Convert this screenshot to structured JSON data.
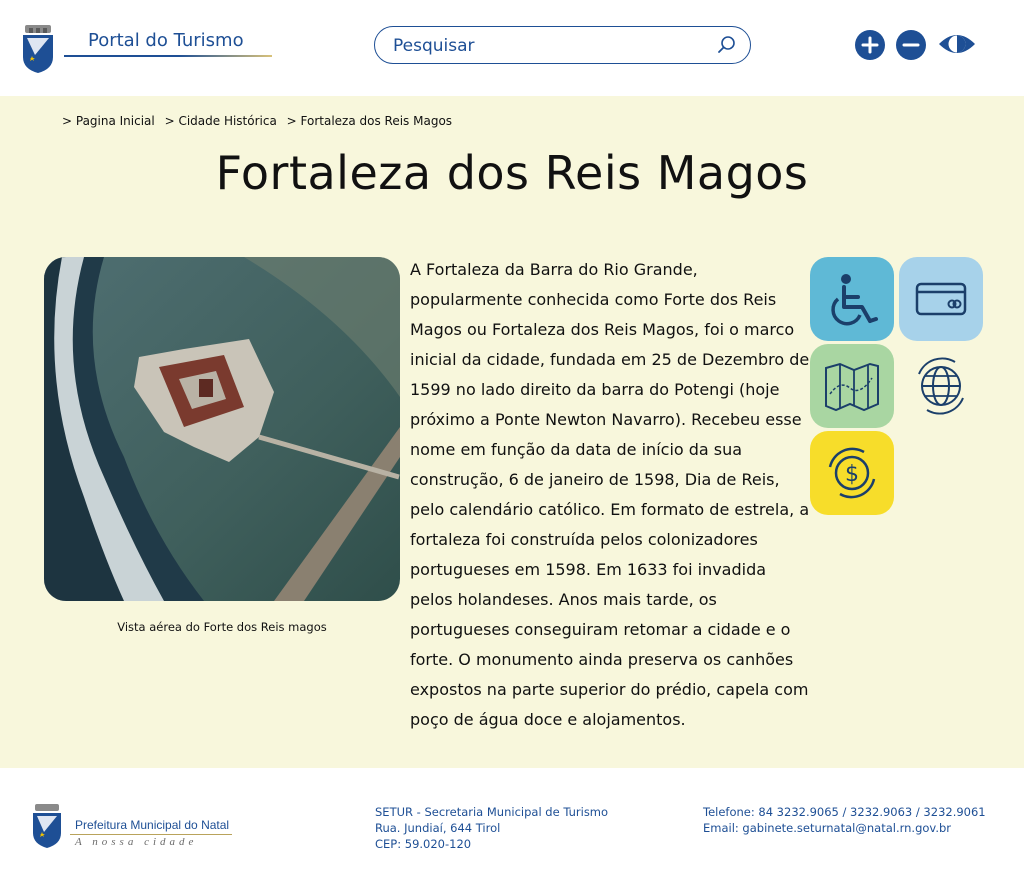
{
  "header": {
    "logo_title": "Portal do Turismo",
    "search_placeholder": "Pesquisar"
  },
  "breadcrumb": [
    "> Pagina Inicial",
    "> Cidade Histórica",
    "> Fortaleza dos Reis Magos"
  ],
  "page": {
    "title": "Fortaleza dos Reis Magos",
    "photo_caption": "Vista aérea do Forte dos Reis magos",
    "article": "A Fortaleza da Barra do Rio Grande, popularmente conhecida como Forte dos Reis Magos ou Fortaleza dos Reis Magos, foi o marco inicial da cidade, fundada em 25 de Dezembro de 1599  no lado direito da barra do Potengi (hoje próximo a Ponte Newton Navarro). Recebeu esse nome em função da data de início da sua construção, 6 de janeiro de 1598, Dia de Reis, pelo calendário católico. Em formato de estrela, a fortaleza foi construída pelos colonizadores portugueses em 1598. Em 1633 foi invadida pelos holandeses. Anos mais tarde, os portugueses conseguiram retomar a cidade e o forte. O monumento ainda preserva os canhões expostos na parte superior do prédio, capela com poço de água doce e alojamentos."
  },
  "tiles": {
    "accessibility_icon": "wheelchair-icon",
    "card_icon": "credit-card-icon",
    "map_icon": "map-icon",
    "globe_icon": "globe-icon",
    "money_icon": "currency-icon"
  },
  "colors": {
    "brand_blue": "#1e4f95",
    "content_bg": "#f8f7dc",
    "tile_blue": "#5fb9d6",
    "tile_light_blue": "#a7d2ea",
    "tile_green": "#a9d6a2",
    "tile_yellow": "#f7dd2a"
  },
  "footer": {
    "org_name": "Prefeitura Municipal do Natal",
    "slogan": "A nossa cidade",
    "setur_name": "SETUR - Secretaria Municipal de Turismo",
    "address": "Rua. Jundiaí, 644 Tirol",
    "cep": "CEP: 59.020-120",
    "phone": "Telefone: 84 3232.9065 / 3232.9063 / 3232.9061",
    "email": "Email: gabinete.seturnatal@natal.rn.gov.br"
  }
}
